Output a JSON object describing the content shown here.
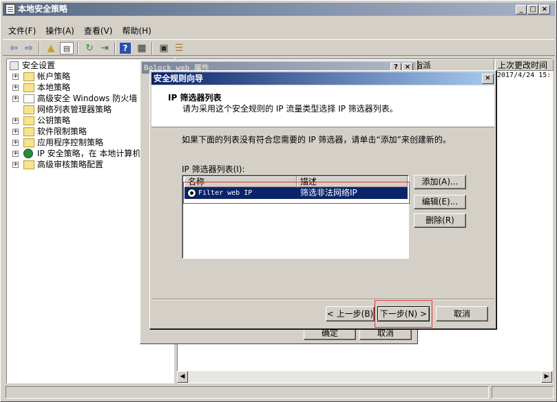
{
  "window": {
    "title": "本地安全策略"
  },
  "menu": [
    "文件(F)",
    "操作(A)",
    "查看(V)",
    "帮助(H)"
  ],
  "tree": {
    "root": "安全设置",
    "items": [
      "帐户策略",
      "本地策略",
      "高级安全 Windows 防火墙",
      "网络列表管理器策略",
      "公钥策略",
      "软件限制策略",
      "应用程序控制策略",
      "IP 安全策略，在 本地计算机",
      "高级审核策略配置"
    ]
  },
  "rightpane": {
    "columns": [
      "指派",
      "上次更改时间"
    ],
    "row_date": "2017/4/24 15:"
  },
  "property_dialog": {
    "title": "Bolock web 属性",
    "help_btn": "?",
    "close_btn": "×",
    "ok": "确定",
    "cancel": "取消"
  },
  "wizard": {
    "title": "安全规则向导",
    "close": "×",
    "heading": "IP 筛选器列表",
    "subheading": "请为采用这个安全规则的 IP 流量类型选择 IP 筛选器列表。",
    "instruction": "如果下面的列表没有符合您需要的 IP 筛选器，请单击“添加”来创建新的。",
    "list_label": "IP 筛选器列表(I):",
    "columns": [
      "名称",
      "描述"
    ],
    "rows": [
      {
        "name": "Filter web IP",
        "desc": "筛选非法网络IP"
      }
    ],
    "add": "添加(A)...",
    "edit": "编辑(E)...",
    "delete": "删除(R)",
    "back": "< 上一步(B)",
    "next": "下一步(N) >",
    "cancel": "取消"
  }
}
